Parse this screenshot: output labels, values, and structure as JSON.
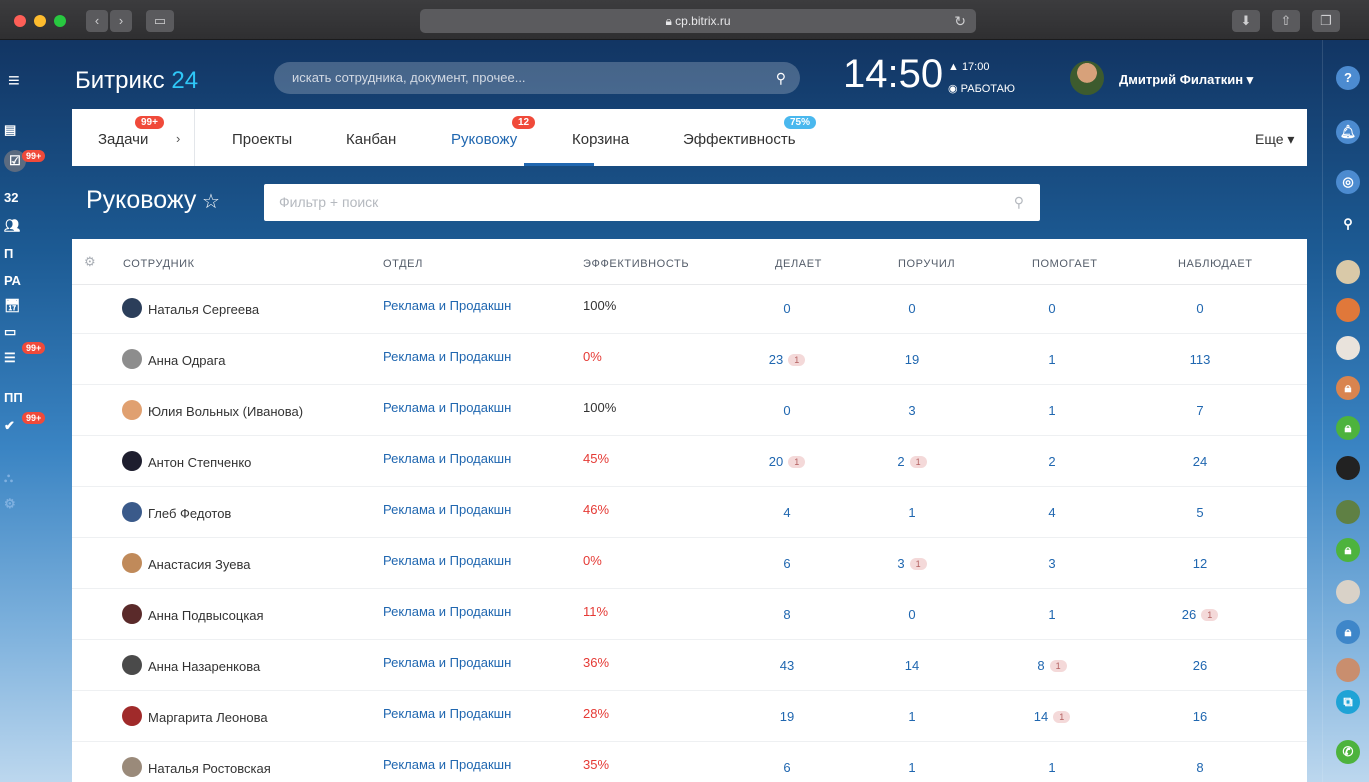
{
  "browser": {
    "url": "cp.bitrix.ru"
  },
  "header": {
    "logo_text": "Битрикс",
    "logo_num": "24",
    "search_placeholder": "искать сотрудника, документ, прочее...",
    "clock": "14:50",
    "work_time": "▲ 17:00",
    "work_status": "◉ РАБОТАЮ",
    "user_name": "Дмитрий Филаткин ▾"
  },
  "leftbar": {
    "items": [
      "32",
      "П",
      "РА",
      "ПП"
    ],
    "badges": [
      "99+",
      "99+",
      "99+"
    ]
  },
  "tabs": {
    "items": [
      {
        "label": "Задачи",
        "badge": "99+"
      },
      {
        "label": "Проекты"
      },
      {
        "label": "Канбан"
      },
      {
        "label": "Руковожу",
        "badge": "12"
      },
      {
        "label": "Корзина"
      },
      {
        "label": "Эффективность",
        "badge": "75%"
      }
    ],
    "more": "Еще ▾"
  },
  "page": {
    "title": "Руковожу",
    "filter_placeholder": "Фильтр + поиск"
  },
  "table": {
    "columns": [
      "СОТРУДНИК",
      "ОТДЕЛ",
      "ЭФФЕКТИВНОСТЬ",
      "ДЕЛАЕТ",
      "ПОРУЧИЛ",
      "ПОМОГАЕТ",
      "НАБЛЮДАЕТ"
    ],
    "rows": [
      {
        "name": "Наталья Сергеева",
        "dept": "Реклама и Продакшн",
        "eff": "100%",
        "does": "0",
        "assigned": "0",
        "helps": "0",
        "watches": "0"
      },
      {
        "name": "Анна Одрага",
        "dept": "Реклама и Продакшн",
        "eff": "0%",
        "does": "23",
        "does_b": "1",
        "assigned": "19",
        "helps": "1",
        "watches": "113"
      },
      {
        "name": "Юлия Вольных (Иванова)",
        "dept": "Реклама и Продакшн",
        "eff": "100%",
        "does": "0",
        "assigned": "3",
        "helps": "1",
        "watches": "7"
      },
      {
        "name": "Антон Степченко",
        "dept": "Реклама и Продакшн",
        "eff": "45%",
        "does": "20",
        "does_b": "1",
        "assigned": "2",
        "assigned_b": "1",
        "helps": "2",
        "watches": "24"
      },
      {
        "name": "Глеб Федотов",
        "dept": "Реклама и Продакшн",
        "eff": "46%",
        "does": "4",
        "assigned": "1",
        "helps": "4",
        "watches": "5"
      },
      {
        "name": "Анастасия Зуева",
        "dept": "Реклама и Продакшн",
        "eff": "0%",
        "does": "6",
        "assigned": "3",
        "assigned_b": "1",
        "helps": "3",
        "watches": "12"
      },
      {
        "name": "Анна Подвысоцкая",
        "dept": "Реклама и Продакшн",
        "eff": "11%",
        "does": "8",
        "assigned": "0",
        "helps": "1",
        "watches": "26",
        "watches_b": "1"
      },
      {
        "name": "Анна Назаренкова",
        "dept": "Реклама и Продакшн",
        "eff": "36%",
        "does": "43",
        "assigned": "14",
        "helps": "8",
        "helps_b": "1",
        "watches": "26"
      },
      {
        "name": "Маргарита Леонова",
        "dept": "Реклама и Продакшн",
        "eff": "28%",
        "does": "19",
        "assigned": "1",
        "helps": "14",
        "helps_b": "1",
        "watches": "16"
      },
      {
        "name": "Наталья Ростовская",
        "dept": "Реклама и Продакшн",
        "eff": "35%",
        "does": "6",
        "assigned": "1",
        "helps": "1",
        "watches": "8"
      }
    ]
  }
}
